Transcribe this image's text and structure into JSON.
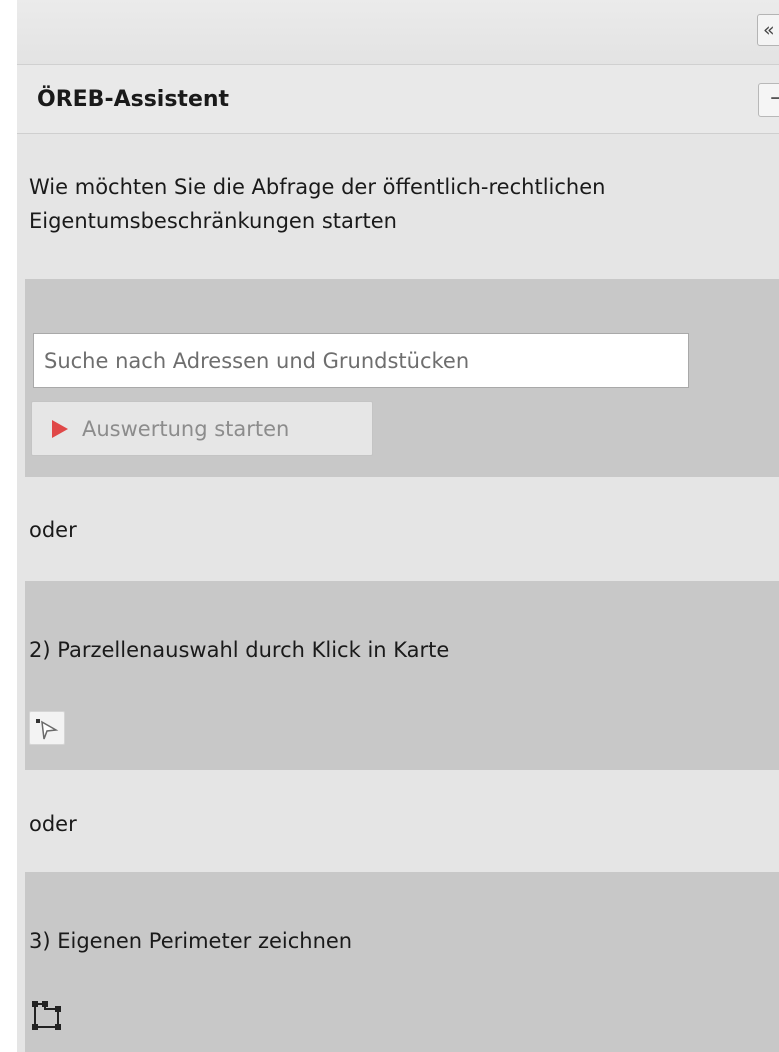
{
  "panel": {
    "collapse_icon": "«",
    "title": "ÖREB-Assistent",
    "minimize_icon": "−"
  },
  "intro": "Wie möchten Sie die Abfrage der öffentlich-rechtlichen Eigentumsbeschränkungen starten",
  "search": {
    "placeholder": "Suche nach Adressen und Grundstücken",
    "start_label": "Auswertung starten",
    "start_icon": "red-arrow-icon"
  },
  "or_label_1": "oder",
  "parcel": {
    "title": "2) Parzellenauswahl durch Klick in Karte",
    "tool_icon": "pointer-select-icon"
  },
  "or_label_2": "oder",
  "perimeter": {
    "title": "3) Eigenen Perimeter zeichnen",
    "tool_icon": "draw-polygon-icon"
  },
  "colors": {
    "panel_bg": "#e5e5e5",
    "section_bg": "#c8c8c8",
    "accent_red": "#e04848"
  }
}
